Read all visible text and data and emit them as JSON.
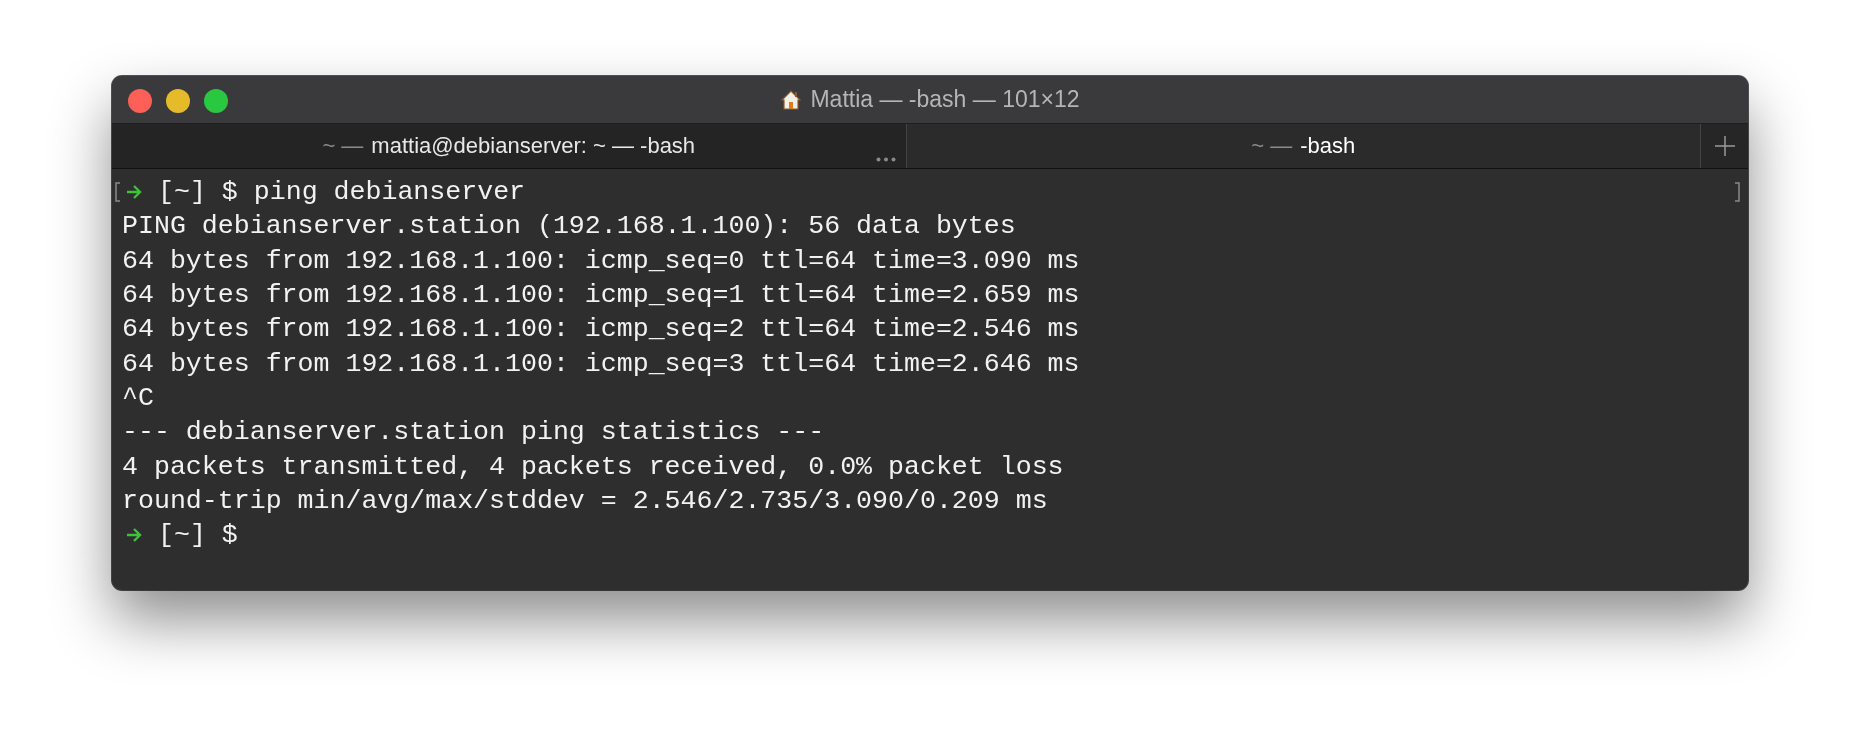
{
  "window": {
    "title": "Mattia — -bash — 101×12"
  },
  "tabs": [
    {
      "prefix": "~ —",
      "label": "mattia@debianserver: ~ — -bash",
      "selected": false,
      "more_menu": true
    },
    {
      "prefix": "~ —",
      "label": "-bash",
      "selected": true,
      "more_menu": false
    }
  ],
  "terminal": {
    "lines": [
      {
        "kind": "prompt",
        "text": "[~] $ ping debianserver",
        "marked": true
      },
      {
        "kind": "output",
        "text": "PING debianserver.station (192.168.1.100): 56 data bytes",
        "marked": false
      },
      {
        "kind": "output",
        "text": "64 bytes from 192.168.1.100: icmp_seq=0 ttl=64 time=3.090 ms",
        "marked": false
      },
      {
        "kind": "output",
        "text": "64 bytes from 192.168.1.100: icmp_seq=1 ttl=64 time=2.659 ms",
        "marked": false
      },
      {
        "kind": "output",
        "text": "64 bytes from 192.168.1.100: icmp_seq=2 ttl=64 time=2.546 ms",
        "marked": false
      },
      {
        "kind": "output",
        "text": "64 bytes from 192.168.1.100: icmp_seq=3 ttl=64 time=2.646 ms",
        "marked": false
      },
      {
        "kind": "output",
        "text": "^C",
        "marked": false
      },
      {
        "kind": "output",
        "text": "--- debianserver.station ping statistics ---",
        "marked": false
      },
      {
        "kind": "output",
        "text": "4 packets transmitted, 4 packets received, 0.0% packet loss",
        "marked": false
      },
      {
        "kind": "output",
        "text": "round-trip min/avg/max/stddev = 2.546/2.735/3.090/0.209 ms",
        "marked": false
      },
      {
        "kind": "prompt",
        "text": "[~] $",
        "marked": false
      }
    ]
  }
}
